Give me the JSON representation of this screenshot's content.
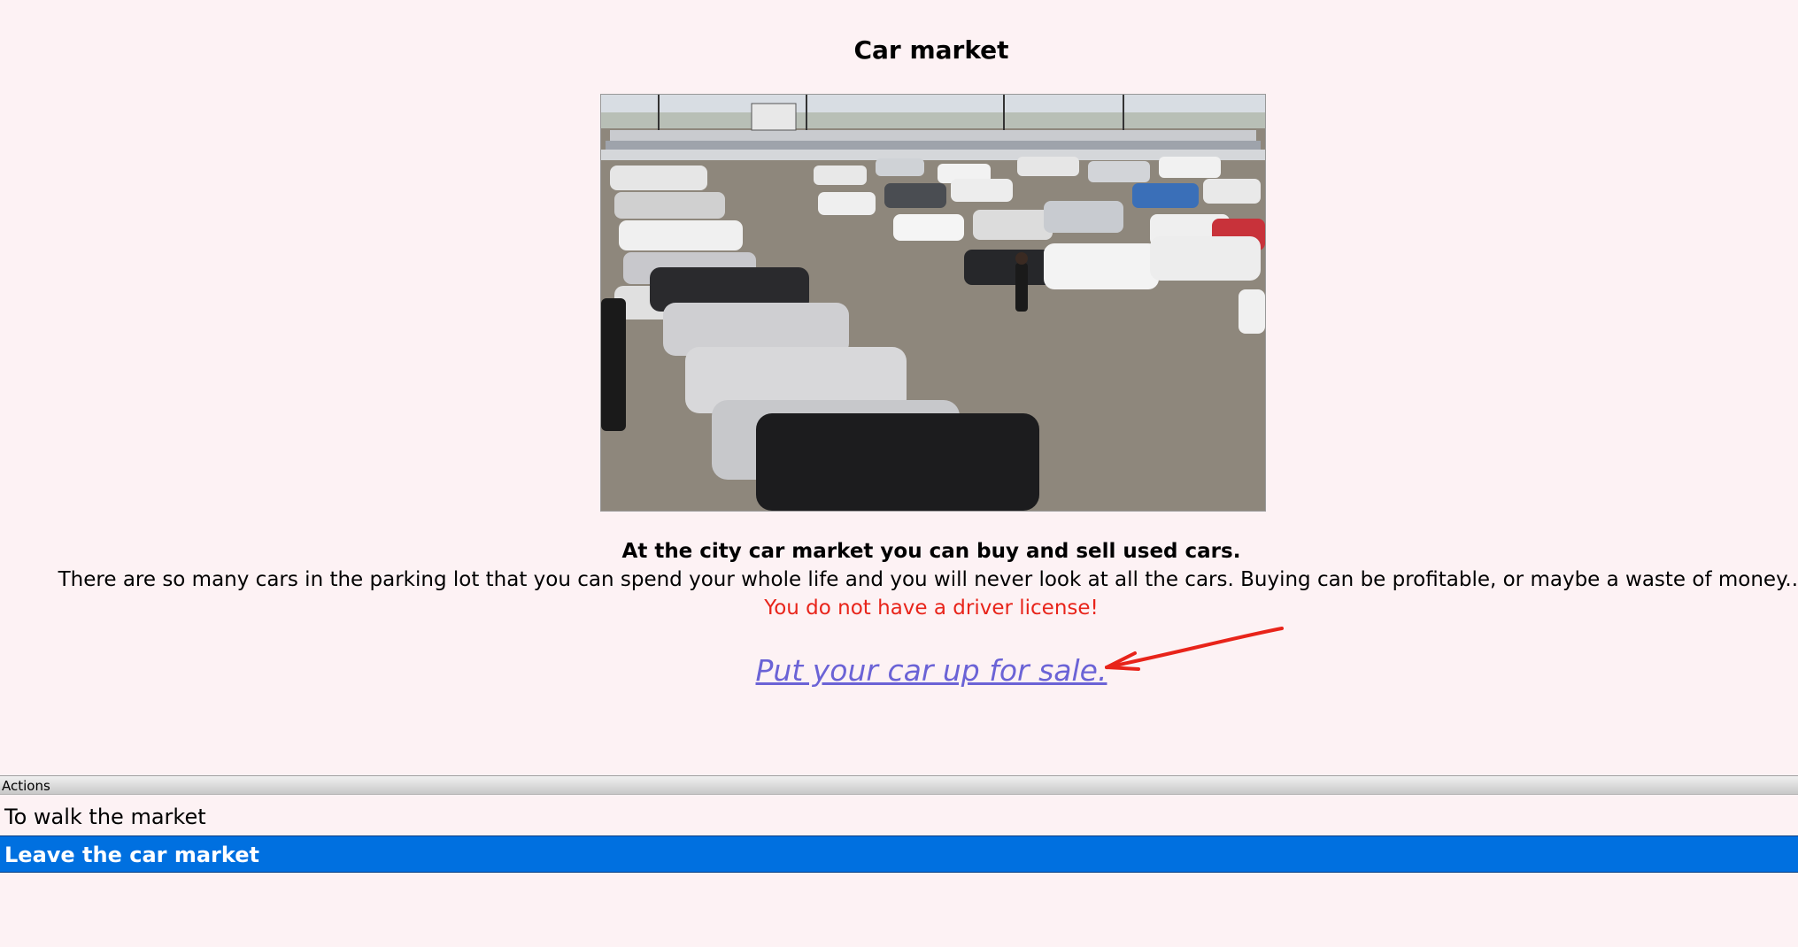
{
  "page": {
    "title": "Car market",
    "image_alt": "Car market parking lot",
    "description_bold": "At the city car market you can buy and sell used cars.",
    "description": "There are so many cars in the parking lot that you can spend your whole life and you will never look at all the cars. Buying can be profitable, or maybe a waste of money...",
    "warning": "You do not have a driver license!",
    "sale_link": "Put your car up for sale."
  },
  "actions": {
    "header": "Actions",
    "items": [
      {
        "label": "To walk the market",
        "selected": false
      },
      {
        "label": "Leave the car market",
        "selected": true
      }
    ]
  },
  "colors": {
    "background": "#fdf2f4",
    "warning": "#e8241a",
    "link": "#6b63d6",
    "selected": "#0070e0"
  }
}
